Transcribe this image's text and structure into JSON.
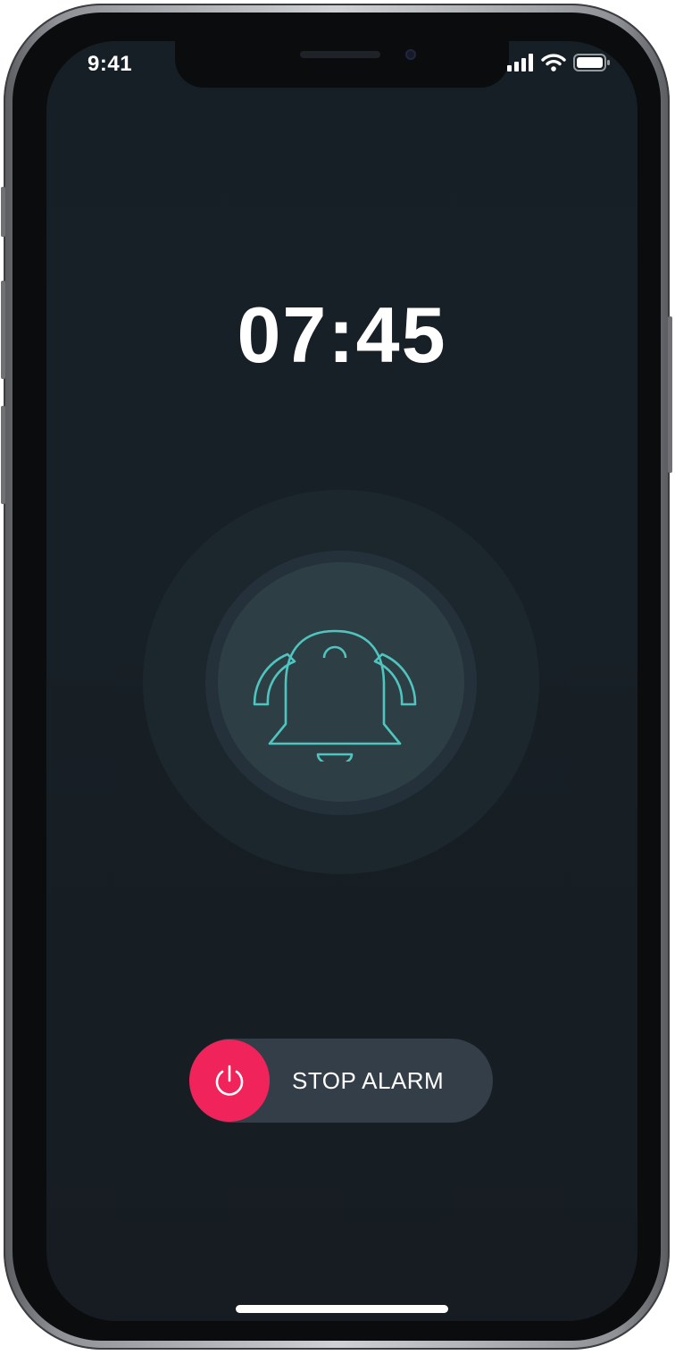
{
  "status_bar": {
    "time": "9:41",
    "icons": [
      "cellular-signal-icon",
      "wifi-icon",
      "battery-icon"
    ]
  },
  "alarm": {
    "time": "07:45",
    "icon": "bell-icon",
    "accent_color": "#4fc5bf"
  },
  "stop_control": {
    "label": "STOP ALARM",
    "icon": "power-icon",
    "color": "#f0245a"
  }
}
